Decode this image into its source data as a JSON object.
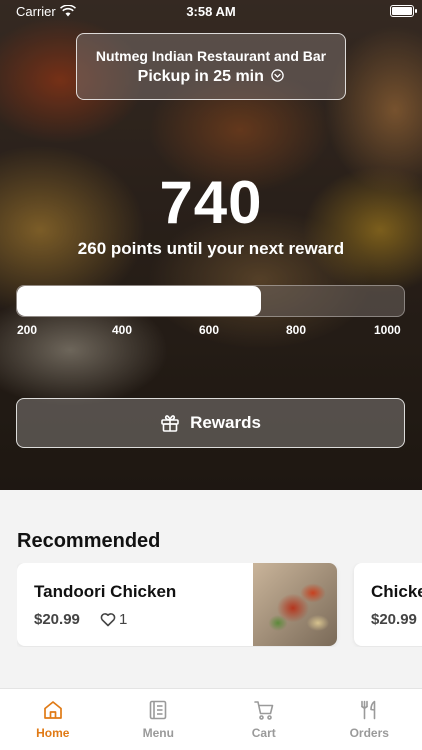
{
  "status_bar": {
    "carrier": "Carrier",
    "time": "3:58 AM"
  },
  "pickup": {
    "restaurant": "Nutmeg Indian Restaurant and Bar",
    "pickup_text": "Pickup in 25 min"
  },
  "rewards": {
    "points": "740",
    "caption": "260 points until your next reward",
    "progress_fraction": 0.63,
    "ticks": [
      "200",
      "400",
      "600",
      "800",
      "1000"
    ],
    "button_label": "Rewards"
  },
  "recommended": {
    "title": "Recommended",
    "items": [
      {
        "name": "Tandoori Chicken",
        "price": "$20.99",
        "likes": "1"
      },
      {
        "name": "Chicke",
        "price": "$20.99"
      }
    ]
  },
  "tabs": [
    {
      "label": "Home",
      "icon": "home-icon",
      "active": true
    },
    {
      "label": "Menu",
      "icon": "menu-icon"
    },
    {
      "label": "Cart",
      "icon": "cart-icon"
    },
    {
      "label": "Orders",
      "icon": "utensils-icon"
    }
  ],
  "colors": {
    "accent": "#e07a16",
    "inactive": "#9a9a9a"
  }
}
